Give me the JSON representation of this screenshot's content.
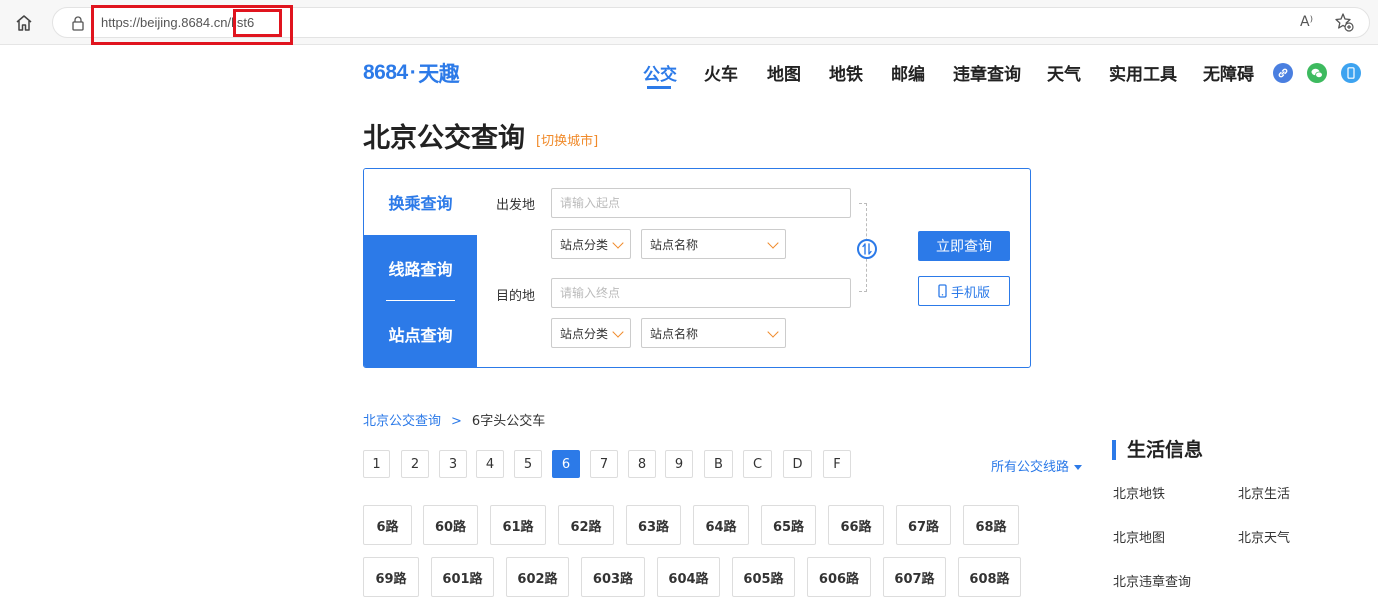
{
  "browser": {
    "url": "https://beijing.8684.cn/list6",
    "read_aloud_label": "A⁾"
  },
  "site": {
    "logo_num": "8684",
    "logo_dot": "·",
    "logo_text": "天趣",
    "brand_color": "#2c7ae8",
    "accent_color": "#f08a2a"
  },
  "nav": {
    "items": [
      {
        "label": "公交"
      },
      {
        "label": "火车"
      },
      {
        "label": "地图"
      },
      {
        "label": "地铁"
      },
      {
        "label": "邮编"
      },
      {
        "label": "违章查询"
      },
      {
        "label": "天气"
      },
      {
        "label": "实用工具"
      },
      {
        "label": "无障碍"
      }
    ],
    "icons": [
      "link-icon",
      "wechat-icon",
      "mobile-icon"
    ]
  },
  "page": {
    "title": "北京公交查询",
    "switch_city": "[切换城市]"
  },
  "search": {
    "tabs": [
      {
        "label": "换乘查询"
      },
      {
        "label": "线路查询"
      },
      {
        "label": "站点查询"
      }
    ],
    "from_label": "出发地",
    "from_placeholder": "请输入起点",
    "to_label": "目的地",
    "to_placeholder": "请输入终点",
    "category_select": "站点分类",
    "name_select": "站点名称",
    "query_button": "立即查询",
    "mobile_button": "手机版"
  },
  "breadcrumb": {
    "home": "北京公交查询",
    "separator": ">",
    "current": "6字头公交车"
  },
  "pagination": {
    "pages": [
      "1",
      "2",
      "3",
      "4",
      "5",
      "6",
      "7",
      "8",
      "9",
      "B",
      "C",
      "D",
      "F"
    ],
    "active": "6",
    "all_routes": "所有公交线路"
  },
  "routes": {
    "row1": [
      "6路",
      "60路",
      "61路",
      "62路",
      "63路",
      "64路",
      "65路",
      "66路",
      "67路",
      "68路"
    ],
    "row2": [
      "69路",
      "601路",
      "602路",
      "603路",
      "604路",
      "605路",
      "606路",
      "607路",
      "608路"
    ]
  },
  "sidebar": {
    "title": "生活信息",
    "links": [
      "北京地铁",
      "北京生活",
      "北京地图",
      "北京天气",
      "北京违章查询"
    ]
  }
}
